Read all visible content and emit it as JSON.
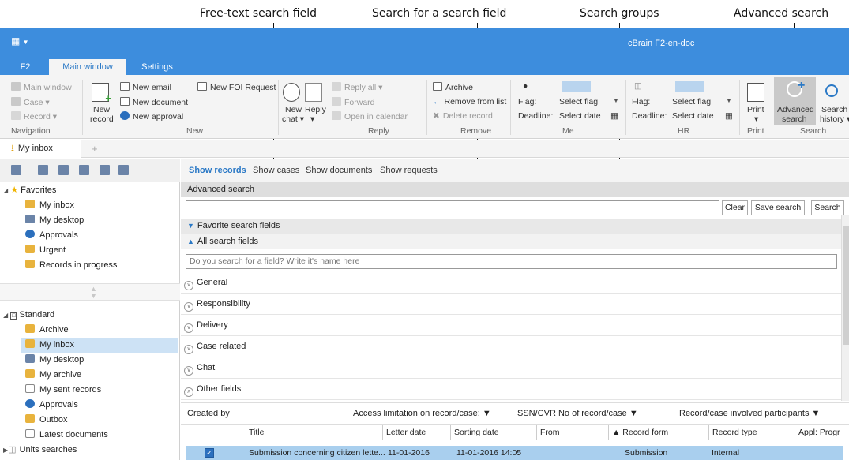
{
  "callouts": {
    "free_text": "Free-text search field",
    "search_field": "Search for a search field",
    "groups": "Search groups",
    "advanced": "Advanced search"
  },
  "titlebar": {
    "app_title": "cBrain F2-en-doc",
    "quick_access": "▼"
  },
  "tabs": [
    "F2",
    "Main window",
    "Settings"
  ],
  "ribbon": {
    "navigation": {
      "main_window": "Main window",
      "case": "Case ▾",
      "record": "Record ▾",
      "label": "Navigation"
    },
    "new": {
      "new_record": "New",
      "new_record2": "record",
      "new_email": "New email",
      "new_document": "New document",
      "new_approval": "New approval",
      "new_foi": "New FOI Request",
      "label": "New"
    },
    "reply": {
      "new_chat": "New",
      "new_chat2": "chat ▾",
      "reply": "Reply",
      "reply2": "▾",
      "reply_all": "Reply all ▾",
      "forward": "Forward",
      "open_calendar": "Open in calendar",
      "label": "Reply"
    },
    "remove": {
      "archive": "Archive",
      "remove_list": "Remove from list",
      "delete_record": "Delete record",
      "label": "Remove"
    },
    "me": {
      "flag_label": "Flag:",
      "flag_value": "Select flag",
      "deadline_label": "Deadline:",
      "deadline_value": "Select date",
      "label": "Me"
    },
    "hr": {
      "flag_label": "Flag:",
      "flag_value": "Select flag",
      "deadline_label": "Deadline:",
      "deadline_value": "Select date",
      "label": "HR"
    },
    "print": {
      "print": "Print",
      "print2": "▾",
      "label": "Print"
    },
    "search": {
      "advanced": "Advanced",
      "advanced2": "search",
      "history": "Search",
      "history2": "history ▾",
      "label": "Search"
    }
  },
  "doc_tab": {
    "label": "My inbox",
    "plus": "+"
  },
  "left": {
    "favorites_header": "Favorites",
    "favorites": [
      "My inbox",
      "My desktop",
      "Approvals",
      "Urgent",
      "Records in progress"
    ],
    "standard_header": "Standard",
    "standard": [
      "Archive",
      "My inbox",
      "My desktop",
      "My archive",
      "My sent records",
      "Approvals",
      "Outbox",
      "Latest documents"
    ],
    "units_searches": "Units searches"
  },
  "main": {
    "subtabs": [
      "Show records",
      "Show cases",
      "Show documents",
      "Show requests"
    ],
    "advanced_header": "Advanced search",
    "buttons": {
      "clear": "Clear",
      "save": "Save search",
      "search": "Search"
    },
    "favorite_fields": "Favorite search fields",
    "all_fields": "All search fields",
    "field_search_placeholder": "Do you search for a field? Write it's name here",
    "groups": [
      "General",
      "Responsibility",
      "Delivery",
      "Case related",
      "Chat",
      "Other fields"
    ],
    "filters": {
      "created_by": "Created by",
      "access": "Access limitation on record/case: ▼",
      "ssn": "SSN/CVR No of record/case ▼",
      "participants": "Record/case involved participants ▼"
    },
    "columns": [
      "Title",
      "Letter date",
      "Sorting date",
      "From",
      "▲ Record form",
      "Record type",
      "Appl: Progr"
    ],
    "row": {
      "title": "Submission concerning citizen lette...",
      "letter_date": "11-01-2016",
      "sorting_date": "11-01-2016 14:05",
      "record_form": "Submission",
      "record_type": "Internal"
    }
  },
  "colors": {
    "accent": "#3d8ddd",
    "selection": "#cde2f5",
    "row_selected": "#a9cfee"
  }
}
